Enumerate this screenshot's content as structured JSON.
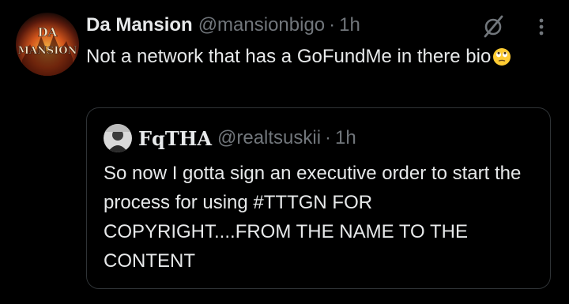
{
  "tweet": {
    "author_name": "Da Mansion",
    "handle": "@mansionbigo",
    "separator": "·",
    "time": "1h",
    "text": "Not a network that has a GoFundMe in there bio",
    "emoji": "face-with-rolling-eyes",
    "avatar_text": "DA MANSION"
  },
  "quote": {
    "author_name": "FqTHA",
    "handle": "@realtsuskii",
    "separator": "·",
    "time": "1h",
    "text": "So now I gotta sign an executive order to start the process for using #TTTGN FOR COPYRIGHT....FROM THE NAME TO THE CONTENT"
  },
  "icons": {
    "grok": "grok-icon",
    "more": "more-icon"
  },
  "colors": {
    "background": "#000000",
    "text_primary": "#e7e9ea",
    "text_secondary": "#71767b",
    "border": "#2f3336"
  }
}
